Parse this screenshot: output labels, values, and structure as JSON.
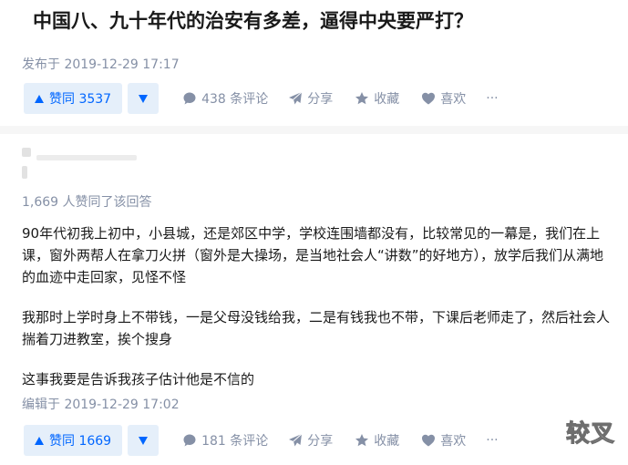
{
  "question": {
    "title": "中国八、九十年代的治安有多差，逼得中央要严打？",
    "published": "发布于 2019-12-29 17:17",
    "actions": {
      "upvote": "赞同 3537",
      "comments": "438 条评论",
      "share": "分享",
      "favorite": "收藏",
      "like": "喜欢",
      "more": "···"
    }
  },
  "answer": {
    "voters": "1,669 人赞同了该回答",
    "paragraphs": [
      "90年代初我上初中，小县城，还是郊区中学，学校连围墙都没有，比较常见的一幕是，我们在上课，窗外两帮人在拿刀火拼（窗外是大操场，是当地社会人“讲数”的好地方），放学后我们从满地的血迹中走回家，见怪不怪",
      "我那时上学时身上不带钱，一是父母没钱给我，二是有钱我也不带，下课后老师走了，然后社会人揣着刀进教室，挨个搜身",
      "这事我要是告诉我孩子估计他是不信的"
    ],
    "edited": "编辑于 2019-12-29 17:02",
    "actions": {
      "upvote": "赞同 1669",
      "comments": "181 条评论",
      "share": "分享",
      "favorite": "收藏",
      "like": "喜欢",
      "more": "···"
    }
  },
  "watermark": "较叉",
  "colors": {
    "accent": "#0066ff",
    "accent_bg": "#e5effa",
    "meta": "#8590a6"
  }
}
